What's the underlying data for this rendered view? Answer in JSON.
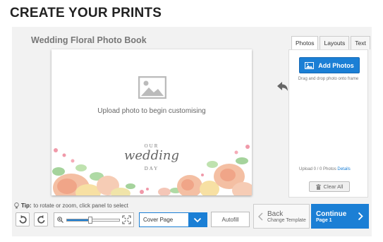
{
  "header": {
    "title": "CREATE YOUR PRINTS"
  },
  "editor": {
    "book_title": "Wedding Floral Photo Book",
    "upload_prompt": "Upload photo to begin customising",
    "cover_text": {
      "line1": "OUR",
      "line2": "wedding",
      "line3": "DAY"
    }
  },
  "side_panel": {
    "tabs": [
      {
        "label": "Photos",
        "active": true
      },
      {
        "label": "Layouts",
        "active": false
      },
      {
        "label": "Text",
        "active": false
      }
    ],
    "add_photos_label": "Add Photos",
    "drag_hint": "Drag and drop photo onto frame",
    "upload_count": "Upload 0 / 0 Photos",
    "details_link": "Details",
    "clear_all_label": "Clear All"
  },
  "toolbar": {
    "tip_label": "Tip:",
    "tip_text": "to rotate or zoom, click panel to select",
    "zoom_level": 0.45,
    "page_select_value": "Cover Page",
    "autofill_label": "Autofill"
  },
  "navigation": {
    "back_label": "Back",
    "back_sub": "Change Template",
    "continue_label": "Continue",
    "continue_sub": "Page 1"
  },
  "colors": {
    "accent": "#1b7fd5",
    "panel_bg": "#f2f2f2"
  }
}
